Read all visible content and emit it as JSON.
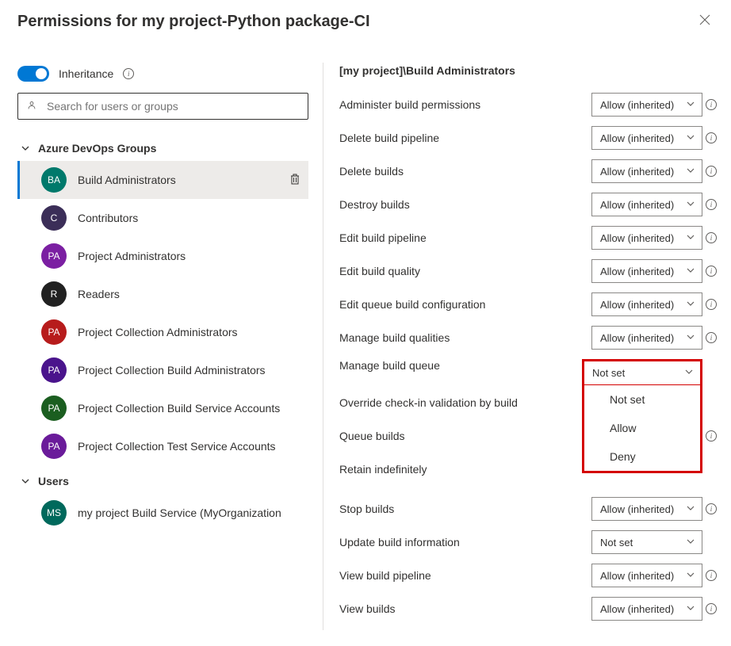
{
  "title": "Permissions for my project-Python package-CI",
  "inheritance_label": "Inheritance",
  "search": {
    "placeholder": "Search for users or groups"
  },
  "sections": {
    "groups_label": "Azure DevOps Groups",
    "users_label": "Users"
  },
  "groups": [
    {
      "initials": "BA",
      "label": "Build Administrators",
      "color": "#00796b",
      "selected": true
    },
    {
      "initials": "C",
      "label": "Contributors",
      "color": "#3b2e58"
    },
    {
      "initials": "PA",
      "label": "Project Administrators",
      "color": "#7b1fa2"
    },
    {
      "initials": "R",
      "label": "Readers",
      "color": "#212121"
    },
    {
      "initials": "PA",
      "label": "Project Collection Administrators",
      "color": "#b71c1c"
    },
    {
      "initials": "PA",
      "label": "Project Collection Build Administrators",
      "color": "#4a148c"
    },
    {
      "initials": "PA",
      "label": "Project Collection Build Service Accounts",
      "color": "#1b5e20"
    },
    {
      "initials": "PA",
      "label": "Project Collection Test Service Accounts",
      "color": "#6a1b9a"
    }
  ],
  "users": [
    {
      "initials": "MS",
      "label": "my project Build Service (MyOrganization",
      "color": "#00695c"
    }
  ],
  "identity_title": "[my project]\\Build Administrators",
  "permissions": [
    {
      "label": "Administer build permissions",
      "value": "Allow (inherited)",
      "info": true
    },
    {
      "label": "Delete build pipeline",
      "value": "Allow (inherited)",
      "info": true
    },
    {
      "label": "Delete builds",
      "value": "Allow (inherited)",
      "info": true
    },
    {
      "label": "Destroy builds",
      "value": "Allow (inherited)",
      "info": true
    },
    {
      "label": "Edit build pipeline",
      "value": "Allow (inherited)",
      "info": true
    },
    {
      "label": "Edit build quality",
      "value": "Allow (inherited)",
      "info": true
    },
    {
      "label": "Edit queue build configuration",
      "value": "Allow (inherited)",
      "info": true
    },
    {
      "label": "Manage build qualities",
      "value": "Allow (inherited)",
      "info": true
    },
    {
      "label": "Manage build queue",
      "value": "Not set",
      "info": false,
      "open": true
    },
    {
      "label": "Override check-in validation by build",
      "value": "",
      "info": false,
      "hidden_by_dropdown": true
    },
    {
      "label": "Queue builds",
      "value": "",
      "info": true,
      "hidden_by_dropdown": true
    },
    {
      "label": "Retain indefinitely",
      "value": "",
      "info": false,
      "hidden_by_dropdown": true
    },
    {
      "label": "Stop builds",
      "value": "Allow (inherited)",
      "info": true
    },
    {
      "label": "Update build information",
      "value": "Not set",
      "info": false
    },
    {
      "label": "View build pipeline",
      "value": "Allow (inherited)",
      "info": true
    },
    {
      "label": "View builds",
      "value": "Allow (inherited)",
      "info": true
    }
  ],
  "dropdown_options": [
    "Not set",
    "Allow",
    "Deny"
  ]
}
